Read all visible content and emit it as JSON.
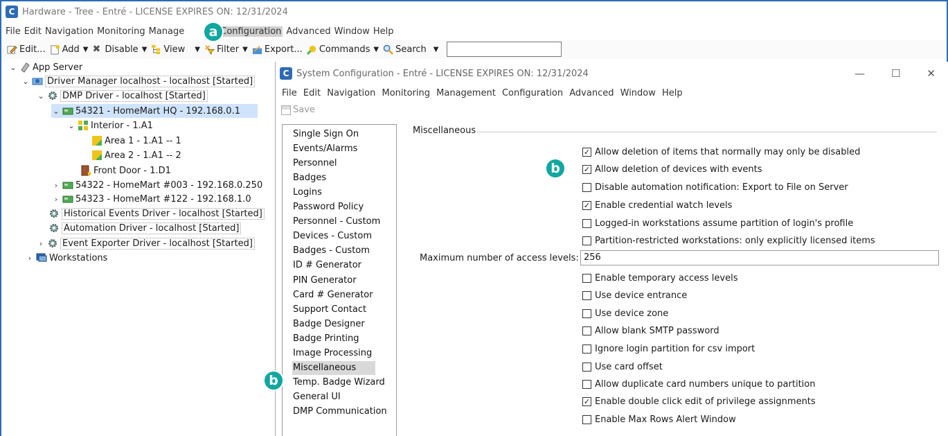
{
  "main_window": {
    "title": "Hardware - Tree - Entré - LICENSE EXPIRES ON: 12/31/2024",
    "app_icon_letter": "C",
    "menu": [
      "File",
      "Edit",
      "Navigation",
      "Monitoring",
      "Manage",
      "Configuration",
      "Advanced",
      "Window",
      "Help"
    ],
    "toolbar": {
      "edit": "Edit...",
      "add": "Add",
      "disable": "Disable",
      "view": "View",
      "filter": "Filter",
      "export": "Export...",
      "commands": "Commands",
      "search": "Search",
      "search_value": ""
    }
  },
  "tree": {
    "app_server": "App Server",
    "driver_manager": "Driver Manager localhost - localhost [Started]",
    "dmp_driver": "DMP Driver - localhost [Started]",
    "panel_hq": "54321 - HomeMart HQ - 192.168.0.1",
    "interior": "Interior - 1.A1",
    "area1": "Area 1 - 1.A1 -- 1",
    "area2": "Area 2 - 1.A1 -- 2",
    "front_door": "Front Door - 1.D1",
    "panel_003": "54322 - HomeMart #003 - 192.168.0.250",
    "panel_122": "54323 - HomeMart #122 - 192.168.1.0",
    "historical": "Historical Events Driver - localhost [Started]",
    "automation": "Automation Driver - localhost [Started]",
    "exporter": "Event Exporter Driver - localhost [Started]",
    "workstations": "Workstations"
  },
  "badges": {
    "a": "a",
    "b": "b"
  },
  "dialog": {
    "title": "System Configuration - Entré - LICENSE EXPIRES ON: 12/31/2024",
    "menu": [
      "File",
      "Edit",
      "Navigation",
      "Monitoring",
      "Management",
      "Configuration",
      "Advanced",
      "Window",
      "Help"
    ],
    "save": "Save",
    "categories": [
      "Single Sign On",
      "Events/Alarms",
      "Personnel",
      "Badges",
      "Logins",
      "Password Policy",
      "Personnel - Custom",
      "Devices - Custom",
      "Badges - Custom",
      "ID # Generator",
      "PIN Generator",
      "Card # Generator",
      "Support Contact",
      "Badge Designer",
      "Badge Printing",
      "Image Processing",
      "Miscellaneous",
      "Temp. Badge Wizard",
      "General UI",
      "DMP Communication"
    ],
    "selected_category": "Miscellaneous",
    "section": "Miscellaneous",
    "options_top": [
      {
        "label": "Allow deletion of items that normally may only be disabled",
        "checked": true
      },
      {
        "label": "Allow deletion of devices with events",
        "checked": true
      },
      {
        "label": "Disable automation notification: Export to File on Server",
        "checked": false
      },
      {
        "label": "Enable credential watch levels",
        "checked": true
      },
      {
        "label": "Logged-in workstations assume partition of login's profile",
        "checked": false
      },
      {
        "label": "Partition-restricted workstations: only explicitly licensed items",
        "checked": false
      }
    ],
    "max_levels_label": "Maximum number of access levels:",
    "max_levels_value": "256",
    "options_bottom": [
      {
        "label": "Enable temporary access levels",
        "checked": false
      },
      {
        "label": "Use device entrance",
        "checked": false
      },
      {
        "label": "Use device zone",
        "checked": false
      },
      {
        "label": "Allow blank SMTP password",
        "checked": false
      },
      {
        "label": "Ignore login partition for csv import",
        "checked": false
      },
      {
        "label": "Use card offset",
        "checked": false
      },
      {
        "label": "Allow duplicate card numbers unique to partition",
        "checked": false
      },
      {
        "label": "Enable double click edit of privilege assignments",
        "checked": true
      },
      {
        "label": "Enable Max Rows Alert Window",
        "checked": false
      }
    ]
  }
}
